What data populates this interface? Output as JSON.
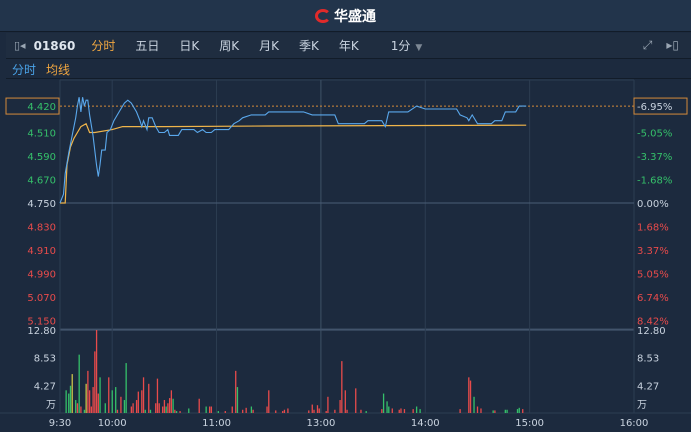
{
  "app": {
    "title": "华盛通",
    "logo": "logo-icon"
  },
  "toolbar": {
    "code": "01860",
    "tabs": [
      "分时",
      "五日",
      "日K",
      "周K",
      "月K",
      "季K",
      "年K"
    ],
    "active_tab": "分时",
    "period": "1分"
  },
  "legend": {
    "price": "分时",
    "avg": "均线"
  },
  "colors": {
    "up": "#e84b4b",
    "down": "#35c06a",
    "neutral": "#c9c24a",
    "price_line": "#5aa8ec",
    "avg_line": "#f0b54a"
  },
  "chart_data": {
    "type": "line",
    "prev_close": 4.75,
    "last_price": 4.42,
    "last_pct": "-6.95%",
    "price_ticks": [
      "5.150",
      "5.070",
      "4.990",
      "4.910",
      "4.830",
      "4.750",
      "4.670",
      "4.590",
      "4.510"
    ],
    "pct_ticks": [
      "8.42%",
      "6.74%",
      "5.05%",
      "3.37%",
      "1.68%",
      "0.00%",
      "-1.68%",
      "-3.37%",
      "-5.05%"
    ],
    "last_price_label": "4.420",
    "volume_ticks": [
      "12.80",
      "8.53",
      "4.27"
    ],
    "volume_unit": "万",
    "time_ticks": [
      "9:30",
      "10:00",
      "11:00",
      "13:00",
      "14:00",
      "15:00",
      "16:00"
    ],
    "time_tick_minutes": [
      0,
      30,
      90,
      150,
      210,
      270,
      330
    ],
    "price": [
      [
        0,
        4.75
      ],
      [
        2,
        4.72
      ],
      [
        3,
        4.65
      ],
      [
        5,
        4.58
      ],
      [
        7,
        4.52
      ],
      [
        9,
        4.46
      ],
      [
        10,
        4.42
      ],
      [
        11,
        4.39
      ],
      [
        12,
        4.44
      ],
      [
        13,
        4.39
      ],
      [
        14,
        4.42
      ],
      [
        15,
        4.4
      ],
      [
        16,
        4.4
      ],
      [
        17,
        4.45
      ],
      [
        19,
        4.52
      ],
      [
        21,
        4.62
      ],
      [
        22,
        4.66
      ],
      [
        23,
        4.62
      ],
      [
        24,
        4.57
      ],
      [
        26,
        4.57
      ],
      [
        27,
        4.51
      ],
      [
        29,
        4.5
      ],
      [
        31,
        4.47
      ],
      [
        34,
        4.44
      ],
      [
        37,
        4.41
      ],
      [
        39,
        4.4
      ],
      [
        41,
        4.41
      ],
      [
        44,
        4.44
      ],
      [
        46,
        4.47
      ],
      [
        47,
        4.49
      ],
      [
        48,
        4.47
      ],
      [
        50,
        4.5
      ],
      [
        51,
        4.46
      ],
      [
        53,
        4.46
      ],
      [
        55,
        4.49
      ],
      [
        57,
        4.51
      ],
      [
        60,
        4.51
      ],
      [
        62,
        4.5
      ],
      [
        63,
        4.52
      ],
      [
        68,
        4.52
      ],
      [
        70,
        4.5
      ],
      [
        77,
        4.5
      ],
      [
        79,
        4.51
      ],
      [
        82,
        4.5
      ],
      [
        84,
        4.51
      ],
      [
        87,
        4.51
      ],
      [
        89,
        4.5
      ],
      [
        97,
        4.5
      ],
      [
        100,
        4.48
      ],
      [
        103,
        4.47
      ],
      [
        105,
        4.46
      ],
      [
        110,
        4.45
      ],
      [
        118,
        4.45
      ],
      [
        120,
        4.44
      ],
      [
        140,
        4.44
      ],
      [
        145,
        4.45
      ],
      [
        158,
        4.45
      ],
      [
        160,
        4.48
      ],
      [
        175,
        4.48
      ],
      [
        177,
        4.47
      ],
      [
        185,
        4.47
      ],
      [
        187,
        4.49
      ],
      [
        189,
        4.44
      ],
      [
        200,
        4.44
      ],
      [
        205,
        4.42
      ],
      [
        210,
        4.43
      ],
      [
        228,
        4.43
      ],
      [
        230,
        4.45
      ],
      [
        234,
        4.46
      ],
      [
        235,
        4.47
      ],
      [
        237,
        4.45
      ],
      [
        240,
        4.48
      ],
      [
        248,
        4.48
      ],
      [
        250,
        4.47
      ],
      [
        254,
        4.47
      ],
      [
        256,
        4.44
      ],
      [
        262,
        4.44
      ],
      [
        264,
        4.42
      ],
      [
        268,
        4.42
      ]
    ],
    "avg": [
      [
        0,
        4.75
      ],
      [
        3,
        4.75
      ],
      [
        4,
        4.62
      ],
      [
        6,
        4.56
      ],
      [
        8,
        4.53
      ],
      [
        10,
        4.51
      ],
      [
        12,
        4.49
      ],
      [
        15,
        4.48
      ],
      [
        17,
        4.51
      ],
      [
        20,
        4.51
      ],
      [
        30,
        4.5
      ],
      [
        36,
        4.49
      ],
      [
        60,
        4.49
      ],
      [
        120,
        4.488
      ],
      [
        268,
        4.485
      ]
    ],
    "volume": [
      [
        3.5,
        3.5,
        "g"
      ],
      [
        5,
        3,
        "g"
      ],
      [
        6,
        4.2,
        "g"
      ],
      [
        7,
        6,
        "y"
      ],
      [
        9,
        2,
        "g"
      ],
      [
        10,
        1.5,
        "r"
      ],
      [
        11,
        9,
        "g"
      ],
      [
        12,
        1,
        "r"
      ],
      [
        14,
        0.5,
        "g"
      ],
      [
        15,
        4.5,
        "y"
      ],
      [
        16,
        6.5,
        "r"
      ],
      [
        17,
        3.5,
        "r"
      ],
      [
        18,
        1,
        "r"
      ],
      [
        19,
        4,
        "r"
      ],
      [
        20,
        9.5,
        "r"
      ],
      [
        21,
        12.8,
        "r"
      ],
      [
        22,
        3,
        "r"
      ],
      [
        23,
        5.5,
        "g"
      ],
      [
        26,
        1.5,
        "g"
      ],
      [
        28,
        5.5,
        "r"
      ],
      [
        30,
        3.5,
        "g"
      ],
      [
        32,
        4,
        "g"
      ],
      [
        33,
        0.5,
        "r"
      ],
      [
        35,
        2.5,
        "r"
      ],
      [
        37,
        2,
        "g"
      ],
      [
        38,
        7.7,
        "g"
      ],
      [
        41,
        1,
        "r"
      ],
      [
        42,
        1.5,
        "r"
      ],
      [
        44,
        2,
        "r"
      ],
      [
        45,
        3.3,
        "r"
      ],
      [
        47,
        3.5,
        "r"
      ],
      [
        48,
        5.5,
        "r"
      ],
      [
        49,
        0.5,
        "g"
      ],
      [
        51,
        4.5,
        "r"
      ],
      [
        52,
        0.5,
        "g"
      ],
      [
        55,
        1.5,
        "r"
      ],
      [
        56,
        5.3,
        "r"
      ],
      [
        57,
        1.5,
        "r"
      ],
      [
        59,
        1,
        "r"
      ],
      [
        60,
        2,
        "r"
      ],
      [
        61,
        1,
        "g"
      ],
      [
        62,
        1.5,
        "r"
      ],
      [
        63,
        2.3,
        "r"
      ],
      [
        64,
        3.5,
        "r"
      ],
      [
        65,
        2.2,
        "g"
      ],
      [
        66,
        0.5,
        "r"
      ],
      [
        67,
        0.3,
        "g"
      ],
      [
        69,
        0.3,
        "r"
      ],
      [
        74,
        0.7,
        "g"
      ],
      [
        80,
        2.2,
        "r"
      ],
      [
        84,
        1,
        "g"
      ],
      [
        86,
        1,
        "r"
      ],
      [
        87,
        1,
        "r"
      ],
      [
        91,
        0.3,
        "g"
      ],
      [
        95,
        0.3,
        "r"
      ],
      [
        99,
        1,
        "r"
      ],
      [
        101,
        6.5,
        "r"
      ],
      [
        102,
        4,
        "g"
      ],
      [
        105,
        0.5,
        "r"
      ],
      [
        107,
        0.8,
        "r"
      ],
      [
        110,
        1,
        "g"
      ],
      [
        111,
        0.5,
        "r"
      ],
      [
        119,
        1,
        "r"
      ],
      [
        120,
        3.5,
        "r"
      ],
      [
        124,
        0.4,
        "r"
      ],
      [
        128,
        0.3,
        "r"
      ],
      [
        129,
        0.5,
        "r"
      ],
      [
        131,
        0.7,
        "r"
      ],
      [
        143,
        0.4,
        "r"
      ],
      [
        145,
        1.3,
        "r"
      ],
      [
        146,
        0.5,
        "r"
      ],
      [
        148,
        1.2,
        "r"
      ],
      [
        149,
        0.7,
        "r"
      ],
      [
        153,
        0.3,
        "r"
      ],
      [
        154,
        2.5,
        "r"
      ],
      [
        158,
        0.5,
        "r"
      ],
      [
        161,
        2,
        "r"
      ],
      [
        162,
        8,
        "r"
      ],
      [
        164,
        3.5,
        "r"
      ],
      [
        165,
        0.5,
        "r"
      ],
      [
        170,
        3.8,
        "r"
      ],
      [
        173,
        0.5,
        "r"
      ],
      [
        176,
        0.3,
        "g"
      ],
      [
        185,
        0.6,
        "r"
      ],
      [
        186,
        3,
        "g"
      ],
      [
        188,
        1.8,
        "g"
      ],
      [
        189,
        1,
        "g"
      ],
      [
        191,
        0.7,
        "r"
      ],
      [
        195,
        0.5,
        "r"
      ],
      [
        196,
        0.7,
        "r"
      ],
      [
        198,
        0.6,
        "r"
      ],
      [
        203,
        0.6,
        "r"
      ],
      [
        205,
        1,
        "g"
      ],
      [
        207,
        0.6,
        "g"
      ],
      [
        230,
        0.6,
        "r"
      ],
      [
        235,
        5.5,
        "r"
      ],
      [
        236,
        5,
        "r"
      ],
      [
        238,
        2.5,
        "g"
      ],
      [
        240,
        1,
        "r"
      ],
      [
        242,
        0.7,
        "r"
      ],
      [
        249,
        0.4,
        "g"
      ],
      [
        250,
        0.4,
        "r"
      ],
      [
        256,
        0.5,
        "g"
      ],
      [
        257,
        0.5,
        "g"
      ],
      [
        263,
        0.6,
        "g"
      ],
      [
        264,
        0.8,
        "g"
      ],
      [
        266,
        0.6,
        "r"
      ]
    ],
    "volume_max": 12.8
  }
}
